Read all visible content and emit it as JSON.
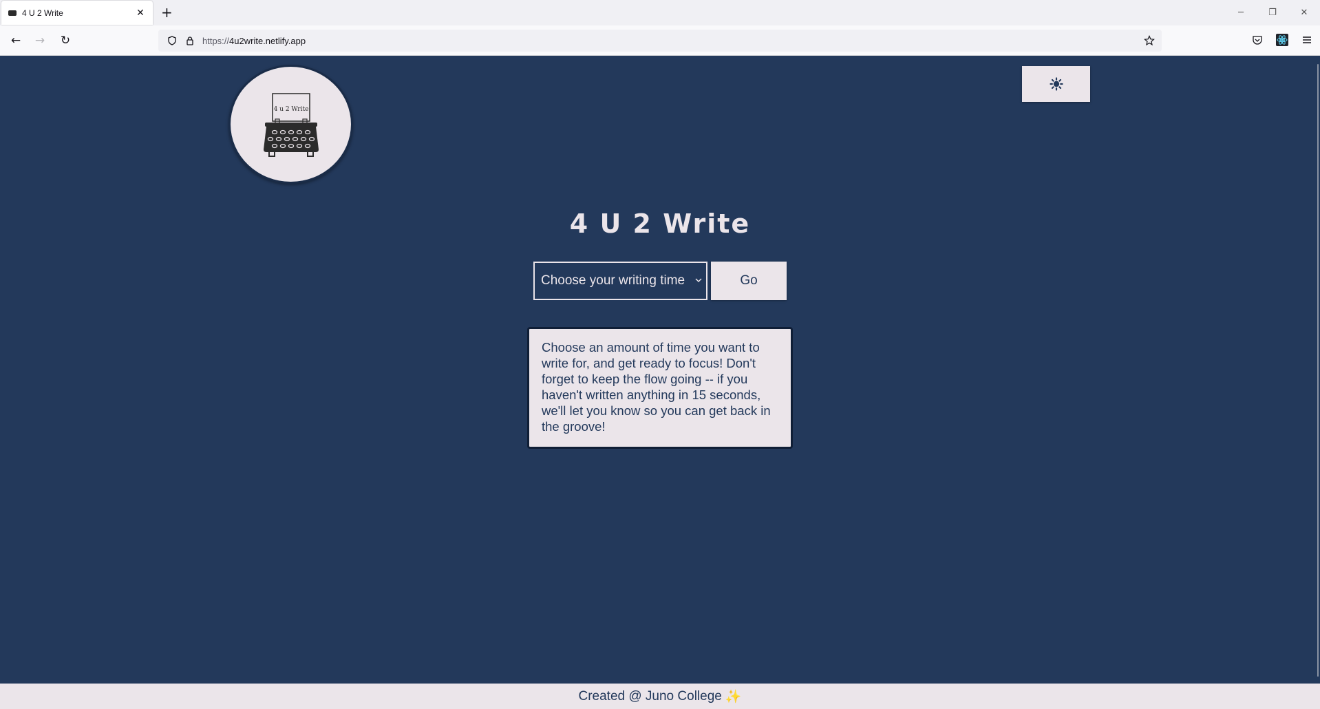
{
  "browser": {
    "tab_title": "4 U 2 Write",
    "tab_close": "✕",
    "new_tab": "+",
    "url_prefix": "https://",
    "url_host": "4u2write.netlify.app",
    "window_controls": {
      "minimize": "─",
      "restore": "❐",
      "close": "✕"
    },
    "nav_icons": {
      "back": "←",
      "forward": "→",
      "reload": "↻"
    }
  },
  "header": {
    "logo_text": "4 u 2 Write",
    "theme_toggle_icon": "sun-icon"
  },
  "main": {
    "title": "4 U 2 Write",
    "select_value": "Choose your writing time",
    "go_label": "Go",
    "info_text": "Choose an amount of time you want to write for, and get ready to focus! Don't forget to keep the flow going -- if you haven't written anything in 15 seconds, we'll let you know so you can get back in the groove!"
  },
  "footer": {
    "text": "Created @ Juno College",
    "emoji": "✨"
  },
  "colors": {
    "page_bg": "#23395b",
    "light": "#ebe5ea"
  }
}
